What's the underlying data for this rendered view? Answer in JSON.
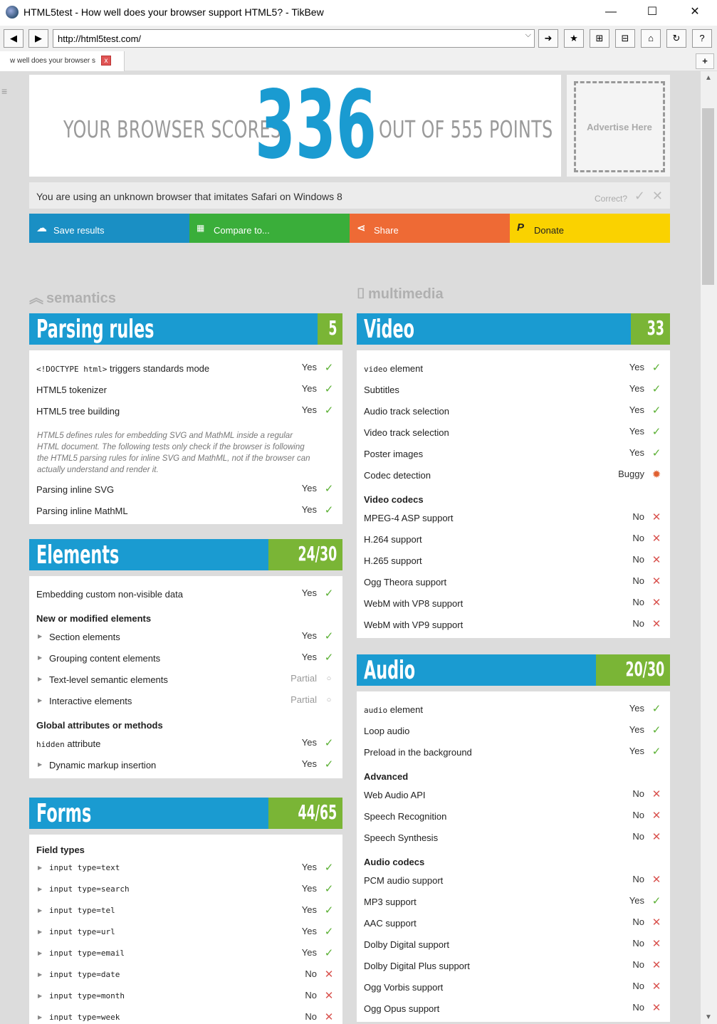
{
  "window": {
    "title": "HTML5test - How well does your browser support HTML5? - TikBew",
    "minimize": "—",
    "maximize": "☐",
    "close": "✕"
  },
  "toolbar": {
    "url": "http://html5test.com/"
  },
  "tab": {
    "label": "w well does your browser s",
    "close": "x"
  },
  "score": {
    "prefix": "YOUR BROWSER SCORES",
    "value": "336",
    "suffix": "OUT OF 555 POINTS"
  },
  "ad": {
    "label": "Advertise Here"
  },
  "browser_info": {
    "text": "You are using an unknown browser that imitates Safari on Windows 8",
    "correct_label": "Correct?"
  },
  "actions": [
    {
      "label": "Save results",
      "color": "#1a8fc4",
      "icon": "cloud-upload-icon"
    },
    {
      "label": "Compare to...",
      "color": "#3aae3a",
      "icon": "grid-icon"
    },
    {
      "label": "Share",
      "color": "#ee6a35",
      "icon": "share-icon"
    },
    {
      "label": "Donate",
      "color": "#fad200",
      "icon": "paypal-icon"
    }
  ],
  "categories": {
    "left": "semantics",
    "right": "multimedia"
  },
  "sections": {
    "parsing": {
      "name": "Parsing rules",
      "score": "5",
      "rows": [
        {
          "label_code": "<!DOCTYPE html>",
          "label": " triggers standards mode",
          "value": "Yes"
        },
        {
          "label": "HTML5 tokenizer",
          "value": "Yes"
        },
        {
          "label": "HTML5 tree building",
          "value": "Yes"
        }
      ],
      "note": "HTML5 defines rules for embedding SVG and MathML inside a regular HTML document. The following tests only check if the browser is following the HTML5 parsing rules for inline SVG and MathML, not if the browser can actually understand and render it.",
      "rows2": [
        {
          "label": "Parsing inline SVG",
          "value": "Yes"
        },
        {
          "label": "Parsing inline MathML",
          "value": "Yes"
        }
      ]
    },
    "elements": {
      "name": "Elements",
      "score": "24/30",
      "row1": {
        "label": "Embedding custom non-visible data",
        "value": "Yes"
      },
      "group1": "New or modified elements",
      "group1_rows": [
        {
          "label": "Section elements",
          "value": "Yes"
        },
        {
          "label": "Grouping content elements",
          "value": "Yes"
        },
        {
          "label": "Text-level semantic elements",
          "value": "Partial"
        },
        {
          "label": "Interactive elements",
          "value": "Partial"
        }
      ],
      "group2": "Global attributes or methods",
      "hidden_row": {
        "code": "hidden",
        "label": " attribute",
        "value": "Yes"
      },
      "dynamic_row": {
        "label": "Dynamic markup insertion",
        "value": "Yes"
      }
    },
    "forms": {
      "name": "Forms",
      "score": "44/65",
      "group1": "Field types",
      "rows": [
        {
          "label": "input type=text",
          "value": "Yes"
        },
        {
          "label": "input type=search",
          "value": "Yes"
        },
        {
          "label": "input type=tel",
          "value": "Yes"
        },
        {
          "label": "input type=url",
          "value": "Yes"
        },
        {
          "label": "input type=email",
          "value": "Yes"
        },
        {
          "label": "input type=date",
          "value": "No"
        },
        {
          "label": "input type=month",
          "value": "No"
        },
        {
          "label": "input type=week",
          "value": "No"
        }
      ]
    },
    "video": {
      "name": "Video",
      "score": "33",
      "video_row": {
        "code": "video",
        "label": " element",
        "value": "Yes"
      },
      "rows": [
        {
          "label": "Subtitles",
          "value": "Yes"
        },
        {
          "label": "Audio track selection",
          "value": "Yes"
        },
        {
          "label": "Video track selection",
          "value": "Yes"
        },
        {
          "label": "Poster images",
          "value": "Yes"
        },
        {
          "label": "Codec detection",
          "value": "Buggy"
        }
      ],
      "group1": "Video codecs",
      "codec_rows": [
        {
          "label": "MPEG-4 ASP support",
          "value": "No"
        },
        {
          "label": "H.264 support",
          "value": "No"
        },
        {
          "label": "H.265 support",
          "value": "No"
        },
        {
          "label": "Ogg Theora support",
          "value": "No"
        },
        {
          "label": "WebM with VP8 support",
          "value": "No"
        },
        {
          "label": "WebM with VP9 support",
          "value": "No"
        }
      ]
    },
    "audio": {
      "name": "Audio",
      "score": "20/30",
      "audio_row": {
        "code": "audio",
        "label": " element",
        "value": "Yes"
      },
      "rows": [
        {
          "label": "Loop audio",
          "value": "Yes"
        },
        {
          "label": "Preload in the background",
          "value": "Yes"
        }
      ],
      "group1": "Advanced",
      "adv_rows": [
        {
          "label": "Web Audio API",
          "value": "No"
        },
        {
          "label": "Speech Recognition",
          "value": "No"
        },
        {
          "label": "Speech Synthesis",
          "value": "No"
        }
      ],
      "group2": "Audio codecs",
      "codec_rows": [
        {
          "label": "PCM audio support",
          "value": "No"
        },
        {
          "label": "MP3 support",
          "value": "Yes"
        },
        {
          "label": "AAC support",
          "value": "No"
        },
        {
          "label": "Dolby Digital support",
          "value": "No"
        },
        {
          "label": "Dolby Digital Plus support",
          "value": "No"
        },
        {
          "label": "Ogg Vorbis support",
          "value": "No"
        },
        {
          "label": "Ogg Opus support",
          "value": "No"
        }
      ]
    }
  },
  "colors": {
    "header_blue": "#1a9bd1",
    "score_green": "#7ab536",
    "yes": "#5bb034",
    "no": "#d9534f"
  }
}
